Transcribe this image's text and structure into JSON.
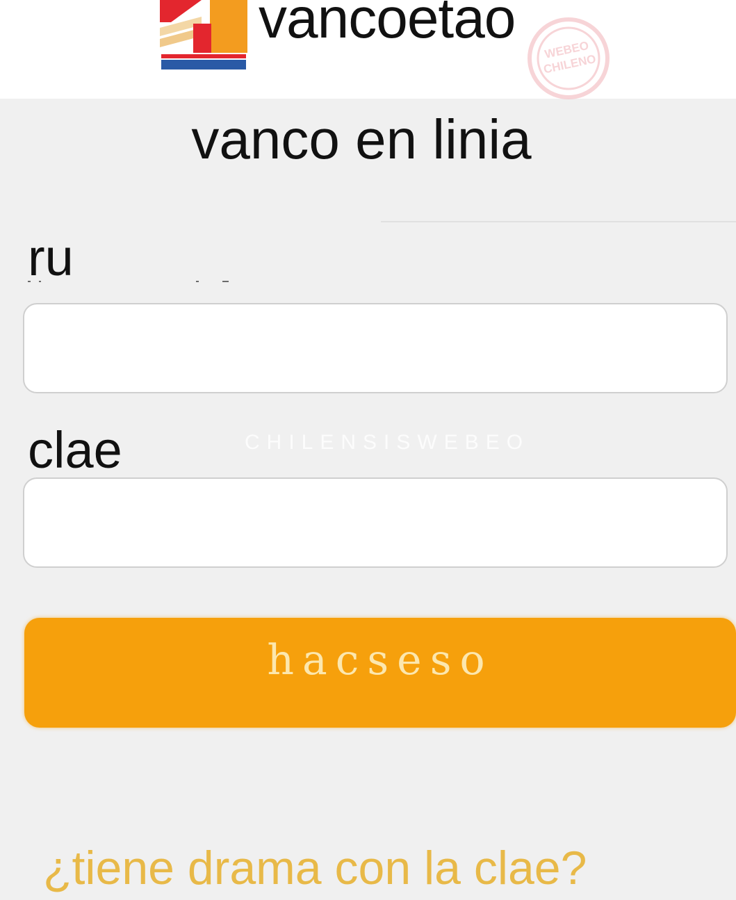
{
  "header": {
    "brand_name": "vancoetao",
    "logo_icon": "bank-logo-icon",
    "stamp_text_top": "WEBEO",
    "stamp_text_bottom": "CHILENO"
  },
  "page": {
    "title": "vanco en linia"
  },
  "form": {
    "rut_label": "ru",
    "rut_value": "",
    "password_label": "clae",
    "password_value": "",
    "submit_label": "hacseso"
  },
  "footer": {
    "forgot_password_link": "¿tiene drama con la clae?"
  },
  "watermark": {
    "text": "CHILENSISWEBEO"
  },
  "colors": {
    "accent_orange": "#f6a00c",
    "button_text": "#fce7ae",
    "link": "#e8b948",
    "header_bg": "#ffffff",
    "page_bg": "#f0f0f0",
    "logo_red": "#e3262e",
    "logo_orange": "#f39c1f",
    "logo_blue": "#2a5aa6",
    "stamp_pink": "#f2b8bd"
  }
}
